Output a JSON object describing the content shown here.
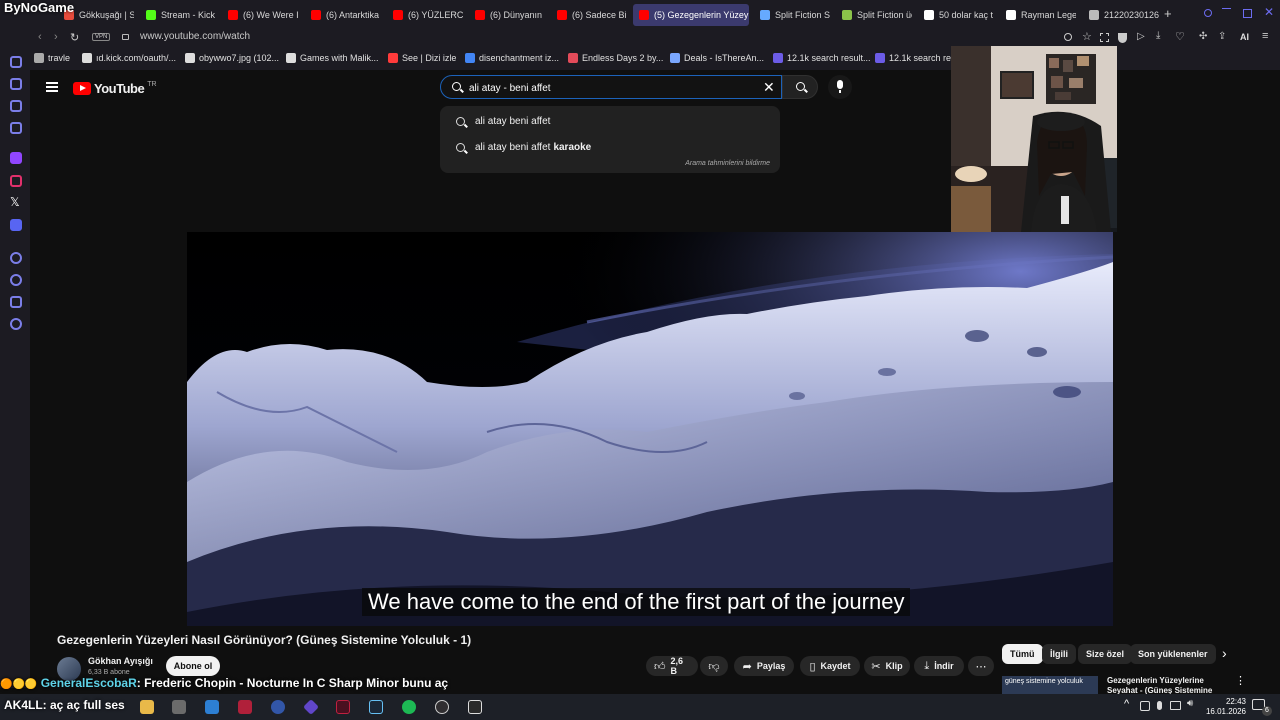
{
  "stream_brand": "ByNoGame",
  "browser": {
    "tabs": [
      {
        "label": "Gökkuşağı | St",
        "fav": "#e74c3c"
      },
      {
        "label": "Stream - Kick",
        "fav": "#53fc18"
      },
      {
        "label": "(6) We Were I",
        "fav": "#ff0000"
      },
      {
        "label": "(6) Antarktika",
        "fav": "#ff0000"
      },
      {
        "label": "(6) YÜZLERC",
        "fav": "#ff0000"
      },
      {
        "label": "(6) Dünyanın",
        "fav": "#ff0000"
      },
      {
        "label": "(6) Sadece Bi",
        "fav": "#ff0000"
      },
      {
        "label": "(5) Gezegenlerin Yüzeyle",
        "fav": "#ff0000"
      },
      {
        "label": "Split Fiction St",
        "fav": "#66aaff"
      },
      {
        "label": "Split Fiction üc",
        "fav": "#8bc34a"
      },
      {
        "label": "50 dolar kaç t",
        "fav": "#ffffff"
      },
      {
        "label": "Rayman Lege",
        "fav": "#ffffff"
      },
      {
        "label": "21220230126",
        "fav": "#bbbbbb"
      }
    ],
    "url": "www.youtube.com/watch",
    "vpn_badge": "VPN",
    "ai_label": "AI",
    "bookmarks": [
      {
        "label": "travle",
        "fav": "#aaaaaa"
      },
      {
        "label": "ıd.kick.com/oauth/...",
        "fav": "#dddddd"
      },
      {
        "label": "obywwo7.jpg (102...",
        "fav": "#dddddd"
      },
      {
        "label": "Games with Malik...",
        "fav": "#dddddd"
      },
      {
        "label": "See | Dizi izle",
        "fav": "#ff3b3b"
      },
      {
        "label": "disenchantment iz...",
        "fav": "#4285f4"
      },
      {
        "label": "Endless Days 2 by...",
        "fav": "#e34b5a"
      },
      {
        "label": "Deals - IsThereAn...",
        "fav": "#7aa7ff"
      },
      {
        "label": "12.1k search result...",
        "fav": "#6c5ce7"
      },
      {
        "label": "12.1k search res",
        "fav": "#6c5ce7"
      }
    ]
  },
  "youtube": {
    "logo_text": "YouTube",
    "country_code": "TR",
    "search": {
      "query": "ali atay - beni affet",
      "suggestions": [
        {
          "prefix": "ali atay beni affet",
          "suffix": ""
        },
        {
          "prefix": "ali atay beni affet",
          "suffix": "karaoke"
        }
      ],
      "report_text": "Arama tahminlerini bildirme"
    },
    "subtitle": "We have come to the end of the first part of the journey",
    "video_title": "Gezegenlerin Yüzeyleri Nasıl Görünüyor? (Güneş Sistemine Yolculuk - 1)",
    "channel_name": "Gökhan Ayışığı",
    "channel_subs": "6,33 B abone",
    "subscribe_label": "Abone ol",
    "likes": "2,6 B",
    "actions": {
      "share": "Paylaş",
      "save": "Kaydet",
      "clip": "Klip",
      "download": "İndir"
    },
    "chips": [
      "Tümü",
      "İlgili",
      "Size özel",
      "Son yüklenenler"
    ],
    "related_title": "Gezegenlerin Yüzeylerine Seyahat - (Güneş Sistemine",
    "related_thumb_text": "güneş sistemine yolculuk"
  },
  "stream_chat": {
    "user": "GeneralEscobaR",
    "message": ": Frederic Chopin - Nocturne In C Sharp Minor bunu aç"
  },
  "marquee": "AK4LL: aç aç full ses",
  "taskbar": {
    "time": "22:43",
    "date": "16.01.2026",
    "notifications": "6"
  }
}
